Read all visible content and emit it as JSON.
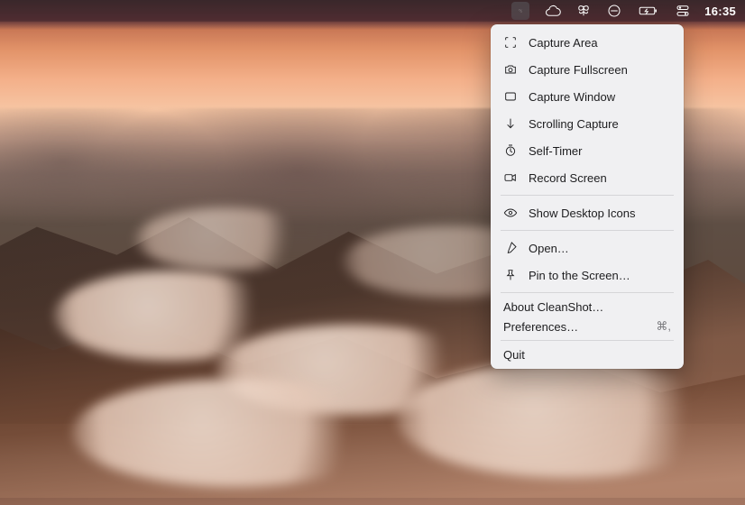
{
  "menubar": {
    "icons": {
      "cleanshot": "cleanshot-icon",
      "cloud": "cloud-icon",
      "butterfly": "butterfly-icon",
      "dnd": "do-not-disturb-icon",
      "battery": "battery-charging-icon",
      "control": "control-center-icon"
    },
    "clock": "16:35"
  },
  "menu": {
    "items": [
      {
        "label": "Capture Area"
      },
      {
        "label": "Capture Fullscreen"
      },
      {
        "label": "Capture Window"
      },
      {
        "label": "Scrolling Capture"
      },
      {
        "label": "Self-Timer"
      },
      {
        "label": "Record Screen"
      },
      {
        "label": "Show Desktop Icons"
      },
      {
        "label": "Open…"
      },
      {
        "label": "Pin to the Screen…"
      }
    ],
    "about": "About CleanShot…",
    "preferences": {
      "label": "Preferences…",
      "shortcut": "⌘,"
    },
    "quit": "Quit"
  }
}
